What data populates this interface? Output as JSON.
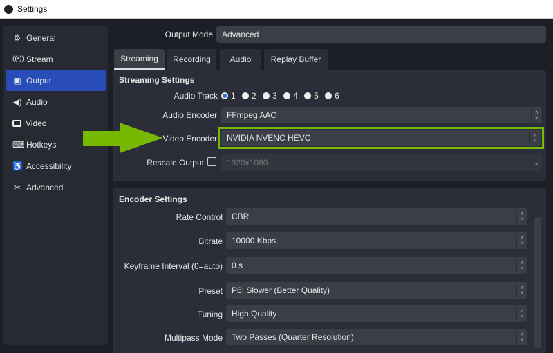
{
  "window": {
    "title": "Settings"
  },
  "sidebar": {
    "items": [
      {
        "label": "General",
        "icon": "gear-icon",
        "glyph": "⚙"
      },
      {
        "label": "Stream",
        "icon": "antenna-icon",
        "glyph": "📡"
      },
      {
        "label": "Output",
        "icon": "output-icon",
        "glyph": "▣",
        "selected": true
      },
      {
        "label": "Audio",
        "icon": "speaker-icon",
        "glyph": "🔊"
      },
      {
        "label": "Video",
        "icon": "monitor-icon",
        "glyph": "▭"
      },
      {
        "label": "Hotkeys",
        "icon": "keyboard-icon",
        "glyph": "⌨"
      },
      {
        "label": "Accessibility",
        "icon": "accessibility-icon",
        "glyph": "♿"
      },
      {
        "label": "Advanced",
        "icon": "tools-icon",
        "glyph": "✂"
      }
    ]
  },
  "output_mode": {
    "label": "Output Mode",
    "value": "Advanced"
  },
  "tabs": [
    "Streaming",
    "Recording",
    "Audio",
    "Replay Buffer"
  ],
  "streaming": {
    "title": "Streaming Settings",
    "audio_track_label": "Audio Track",
    "tracks": [
      "1",
      "2",
      "3",
      "4",
      "5",
      "6"
    ],
    "audio_encoder_label": "Audio Encoder",
    "audio_encoder": "FFmpeg AAC",
    "video_encoder_label": "Video Encoder",
    "video_encoder": "NVIDIA NVENC HEVC",
    "rescale_label": "Rescale Output",
    "rescale_value": "1920x1080"
  },
  "encoder": {
    "title": "Encoder Settings",
    "rows": [
      {
        "label": "Rate Control",
        "value": "CBR"
      },
      {
        "label": "Bitrate",
        "value": "10000 Kbps"
      },
      {
        "label": "Keyframe Interval (0=auto)",
        "value": "0 s"
      },
      {
        "label": "Preset",
        "value": "P6: Slower (Better Quality)"
      },
      {
        "label": "Tuning",
        "value": "High Quality"
      },
      {
        "label": "Multipass Mode",
        "value": "Two Passes (Quarter Resolution)"
      }
    ]
  },
  "colors": {
    "highlight": "#76b900",
    "selected": "#284cb8"
  }
}
